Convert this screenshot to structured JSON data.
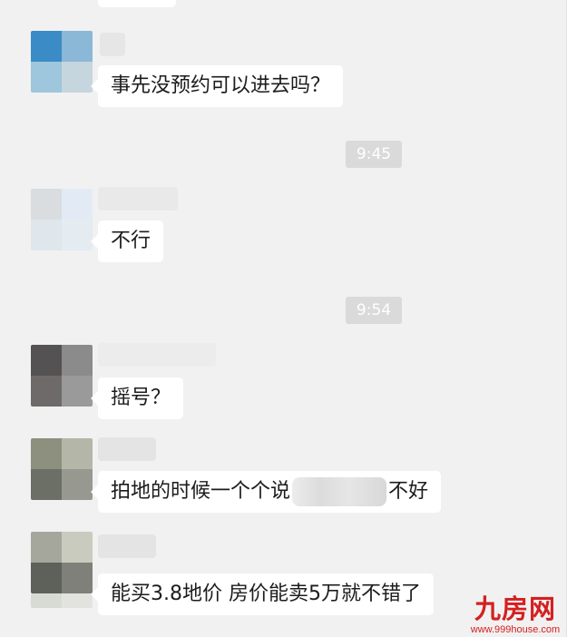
{
  "messages": {
    "m1": "事先没预约可以进去吗？",
    "m2": "不行",
    "m3": "摇号？",
    "m4_before": "拍地的时候一个个说",
    "m4_after": "不好",
    "m5": "能买3.8地价  房价能卖5万就不错了"
  },
  "timestamps": {
    "t1": "9:45",
    "t2": "9:54"
  },
  "watermark": {
    "logo": "九房网",
    "url": "www.999house.com"
  },
  "colors": {
    "background": "#f1f1f1",
    "bubble": "#ffffff",
    "timestamp_bg": "#dadada",
    "watermark": "#d42020"
  }
}
